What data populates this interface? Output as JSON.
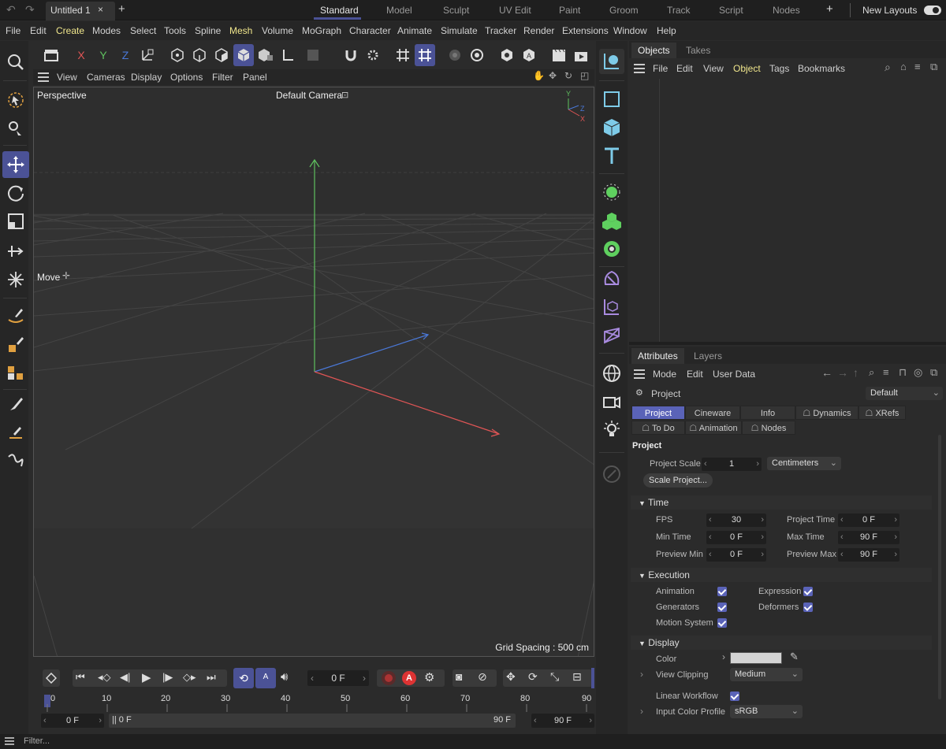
{
  "doc_tab": {
    "title": "Untitled 1",
    "close": "×",
    "add": "+"
  },
  "layouts": {
    "items": [
      "Standard",
      "Model",
      "Sculpt",
      "UV Edit",
      "Paint",
      "Groom",
      "Track",
      "Script",
      "Nodes"
    ],
    "active": "Standard",
    "add": "+",
    "new_layouts": "New Layouts"
  },
  "menu": [
    "File",
    "Edit",
    "Create",
    "Modes",
    "Select",
    "Tools",
    "Spline",
    "Mesh",
    "Volume",
    "MoGraph",
    "Character",
    "Animate",
    "Simulate",
    "Tracker",
    "Render",
    "Extensions",
    "Window",
    "Help"
  ],
  "axis_buttons": {
    "x": "X",
    "y": "Y",
    "z": "Z"
  },
  "viewport_menu": [
    "View",
    "Cameras",
    "Display",
    "Options",
    "Filter",
    "Panel"
  ],
  "viewport": {
    "view_name": "Perspective",
    "camera": "Default Camera",
    "tool_label": "Move",
    "grid_spacing": "Grid Spacing : 500 cm",
    "gizmo": {
      "y": "Y",
      "z": "Z",
      "x": "X"
    }
  },
  "objects_panel": {
    "tabs": [
      "Objects",
      "Takes"
    ],
    "menu": [
      "File",
      "Edit",
      "View",
      "Object",
      "Tags",
      "Bookmarks"
    ],
    "highlight": "Object"
  },
  "attributes_panel": {
    "tabs": [
      "Attributes",
      "Layers"
    ],
    "menu": [
      "Mode",
      "Edit",
      "User Data"
    ],
    "object_label": "Project",
    "preset": "Default",
    "sub_tabs_row1": [
      "Project",
      "Cineware",
      "Info",
      "Dynamics",
      "XRefs"
    ],
    "sub_tabs_row2": [
      "To Do",
      "Animation",
      "Nodes"
    ],
    "section_title": "Project",
    "project_scale_label": "Project Scale",
    "project_scale_value": "1",
    "project_scale_unit": "Centimeters",
    "scale_project_button": "Scale Project...",
    "time": {
      "title": "Time",
      "fps_label": "FPS",
      "fps": "30",
      "project_time_label": "Project Time",
      "project_time": "0 F",
      "min_time_label": "Min Time",
      "min_time": "0 F",
      "max_time_label": "Max Time",
      "max_time": "90 F",
      "preview_min_label": "Preview Min",
      "preview_min": "0 F",
      "preview_max_label": "Preview Max",
      "preview_max": "90 F"
    },
    "execution": {
      "title": "Execution",
      "animation": "Animation",
      "expression": "Expression",
      "generators": "Generators",
      "deformers": "Deformers",
      "motion_system": "Motion System"
    },
    "display": {
      "title": "Display",
      "color_label": "Color",
      "color_value": "#d4d4d4",
      "view_clipping_label": "View Clipping",
      "view_clipping": "Medium",
      "linear_workflow_label": "Linear Workflow",
      "input_color_profile_label": "Input Color Profile",
      "input_color_profile": "sRGB"
    }
  },
  "timeline": {
    "current_frame": "0 F",
    "ticks": [
      "0",
      "10",
      "20",
      "30",
      "40",
      "50",
      "60",
      "70",
      "80",
      "90"
    ],
    "range_start": "0 F",
    "range_from": "0 F",
    "range_to": "90 F",
    "range_end": "90 F",
    "autokey": "A"
  },
  "status": {
    "filter_placeholder": "Filter..."
  },
  "colors": {
    "accent": "#4b5296",
    "highlight_menu": "#f0e68c",
    "x_axis": "#e05555",
    "y_axis": "#5fc15f",
    "z_axis": "#4a78d8"
  }
}
